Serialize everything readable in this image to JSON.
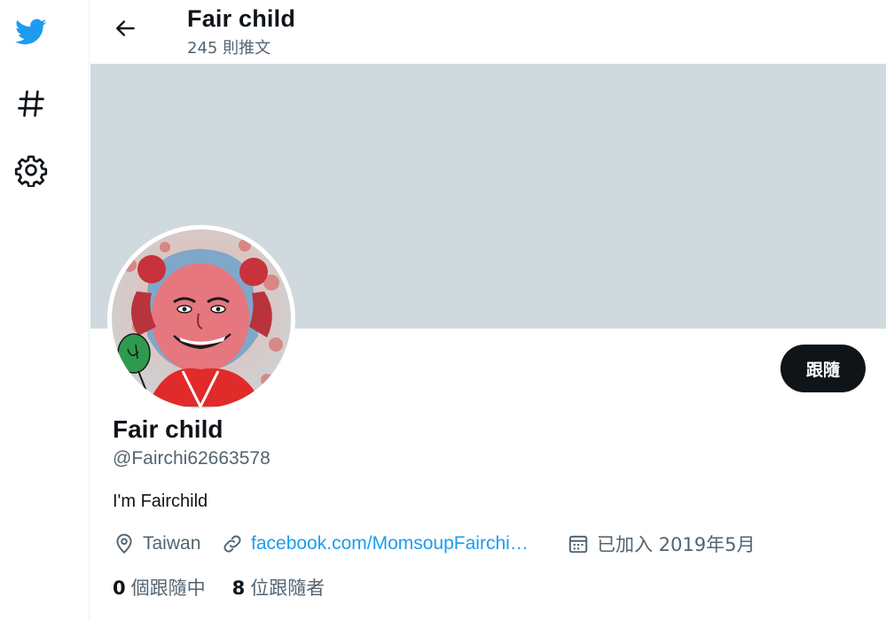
{
  "header": {
    "title": "Fair child",
    "tweet_count": "245 則推文"
  },
  "profile": {
    "display_name": "Fair child",
    "handle": "@Fairchi62663578",
    "bio": "I'm Fairchild",
    "location": "Taiwan",
    "link": "facebook.com/MomsoupFairchi…",
    "joined": "已加入 2019年5月",
    "following_count": "0",
    "following_label": "個跟隨中",
    "followers_count": "8",
    "followers_label": "位跟隨者"
  },
  "actions": {
    "follow_label": "跟隨"
  },
  "nav": {
    "icons": [
      "twitter-logo-icon",
      "hashtag-icon",
      "gear-icon"
    ]
  },
  "colors": {
    "brand": "#1d9bf0",
    "banner": "#cfd9de",
    "text": "#0f1419",
    "muted": "#536471"
  }
}
